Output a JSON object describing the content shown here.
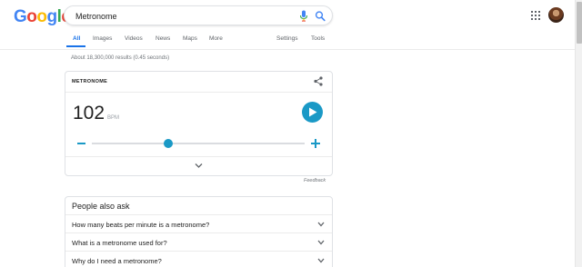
{
  "logo": {
    "letters": [
      {
        "ch": "G",
        "color": "#4285F4"
      },
      {
        "ch": "o",
        "color": "#EA4335"
      },
      {
        "ch": "o",
        "color": "#FBBC05"
      },
      {
        "ch": "g",
        "color": "#4285F4"
      },
      {
        "ch": "l",
        "color": "#34A853"
      },
      {
        "ch": "e",
        "color": "#EA4335"
      }
    ]
  },
  "search": {
    "value": "Metronome"
  },
  "tabs": [
    {
      "label": "All",
      "active": true
    },
    {
      "label": "Images"
    },
    {
      "label": "Videos"
    },
    {
      "label": "News"
    },
    {
      "label": "Maps"
    },
    {
      "label": "More"
    },
    {
      "label": "Settings"
    },
    {
      "label": "Tools"
    }
  ],
  "results_stats": "About 18,300,000 results (0.45 seconds)",
  "metronome": {
    "title": "METRONOME",
    "bpm": "102",
    "unit": "BPM",
    "tempo_fraction": 0.36
  },
  "feedback": "Feedback",
  "people_also_ask": {
    "title": "People also ask",
    "questions": [
      "How many beats per minute is a metronome?",
      "What is a metronome used for?",
      "Why do I need a metronome?"
    ]
  },
  "icons": {
    "mic": "mic-icon",
    "search": "search-icon",
    "apps": "apps-grid-icon",
    "share": "share-icon",
    "play": "play-icon",
    "expand": "chevron-down-icon"
  },
  "colors": {
    "accent": "#1a73e8",
    "metronome": "#1a99c6"
  }
}
